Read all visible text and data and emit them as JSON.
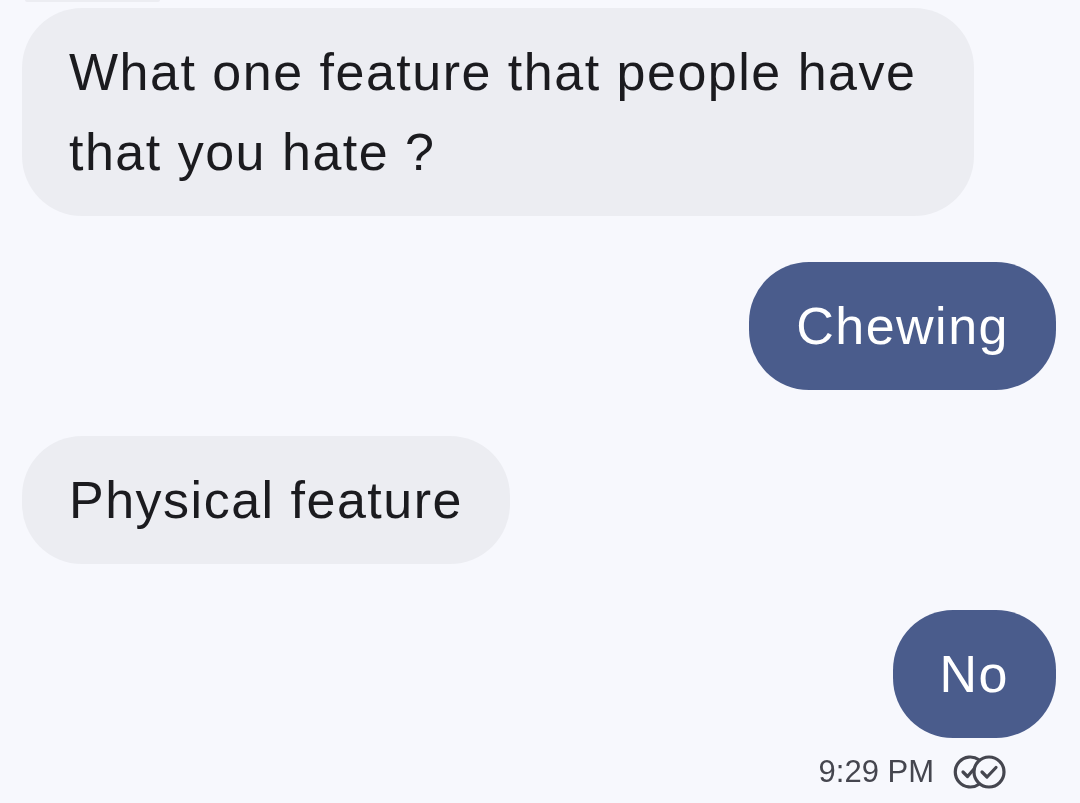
{
  "messages": [
    {
      "kind": "received",
      "text": "What one feature that people have that you hate ?"
    },
    {
      "kind": "sent",
      "text": "Chewing"
    },
    {
      "kind": "received",
      "text": "Physical feature"
    },
    {
      "kind": "sent",
      "text": "No"
    }
  ],
  "footer": {
    "time": "9:29 PM",
    "read": true
  }
}
